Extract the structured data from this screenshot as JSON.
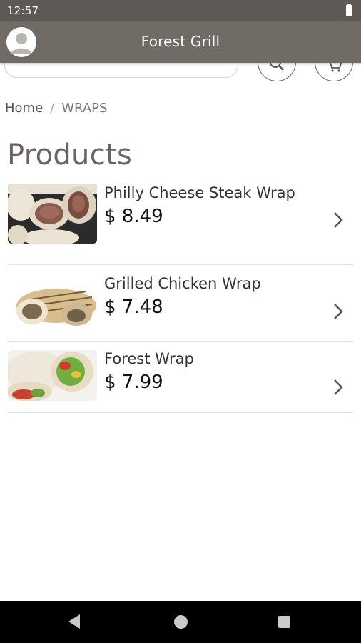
{
  "status_bar": {
    "time": "12:57",
    "icons": [
      "battery-icon"
    ]
  },
  "app_bar": {
    "title": "Forest Grill",
    "avatar_icon": "user-avatar-icon"
  },
  "toolbar": {
    "search_icon": "search-icon",
    "cart_icon": "cart-icon"
  },
  "breadcrumb": {
    "home": "Home",
    "separator": "/",
    "current": "WRAPS"
  },
  "page": {
    "title": "Products"
  },
  "products": [
    {
      "name": "Philly Cheese Steak Wrap",
      "price": "$ 8.49"
    },
    {
      "name": "Grilled Chicken Wrap",
      "price": "$ 7.48"
    },
    {
      "name": "Forest Wrap",
      "price": "$ 7.99"
    }
  ],
  "nav_bar": {
    "icons": [
      "back-icon",
      "home-icon",
      "recents-icon"
    ]
  },
  "colors": {
    "status_bar": "#5e5955",
    "app_bar": "#716b66",
    "title_text": "#6a6562",
    "nav_bar": "#000000"
  }
}
